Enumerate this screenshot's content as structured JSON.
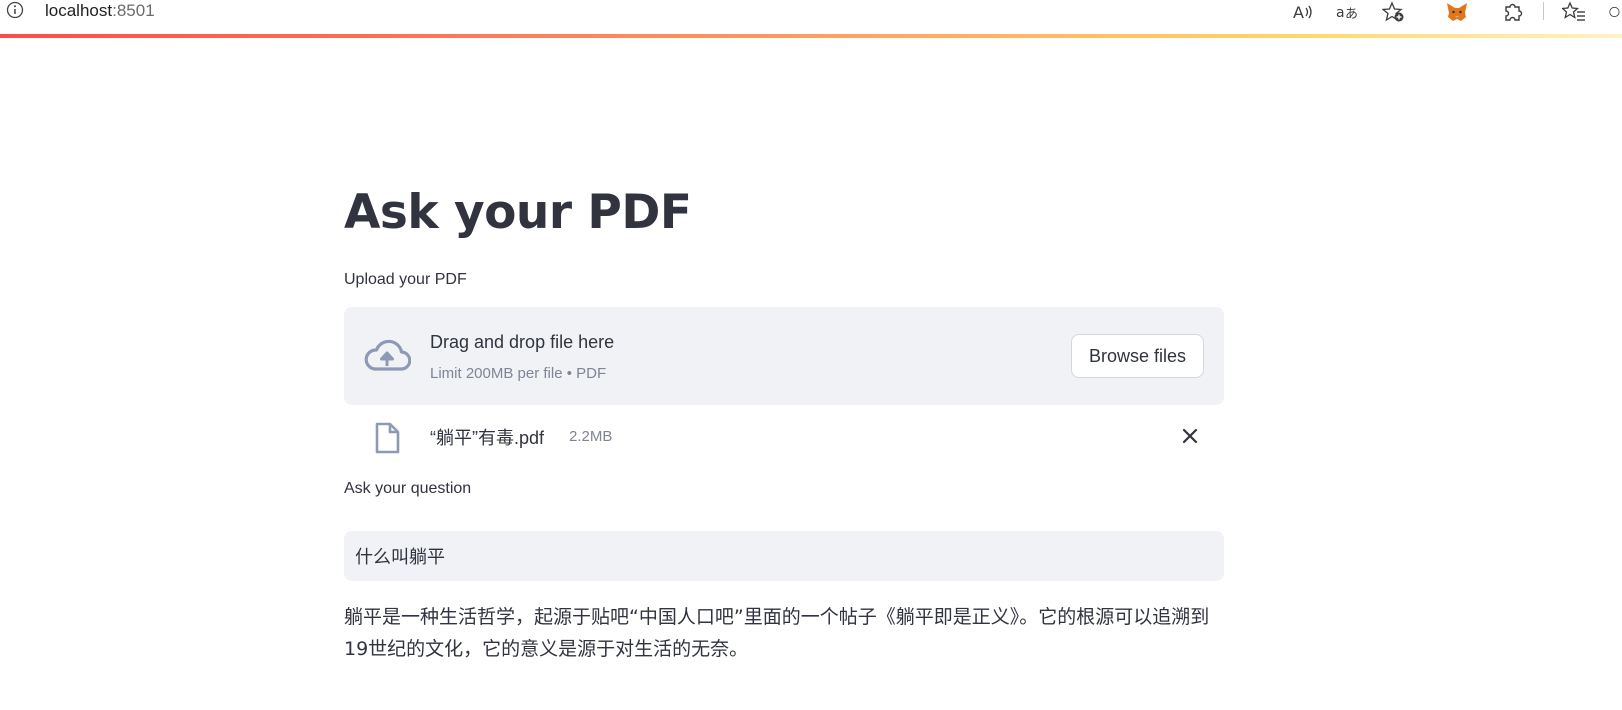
{
  "browser": {
    "url_host": "localhost",
    "url_port": ":8501",
    "icons": [
      "info-icon",
      "read-aloud-icon",
      "translate-icon",
      "favorite-add-icon",
      "metamask-fox-icon",
      "extensions-icon",
      "favorites-icon"
    ]
  },
  "colors": {
    "accent_gradient_start": "#ff4b4b",
    "accent_gradient_end": "#fff3c2",
    "widget_background": "#f0f2f6",
    "text": "#31333f",
    "muted_text": "#808495"
  },
  "app": {
    "title": "Ask your PDF",
    "uploader": {
      "label": "Upload your PDF",
      "drop_title": "Drag and drop file here",
      "drop_subtitle": "Limit 200MB per file • PDF",
      "browse_label": "Browse files",
      "uploaded_file": {
        "name": "“躺平”有毒.pdf",
        "size": "2.2MB"
      }
    },
    "question": {
      "label": "Ask your question",
      "value": "什么叫躺平"
    },
    "answer": "躺平是一种生活哲学，起源于贴吧“中国人口吧”里面的一个帖子《躺平即是正义》。它的根源可以追溯到19世纪的文化，它的意义是源于对生活的无奈。"
  }
}
